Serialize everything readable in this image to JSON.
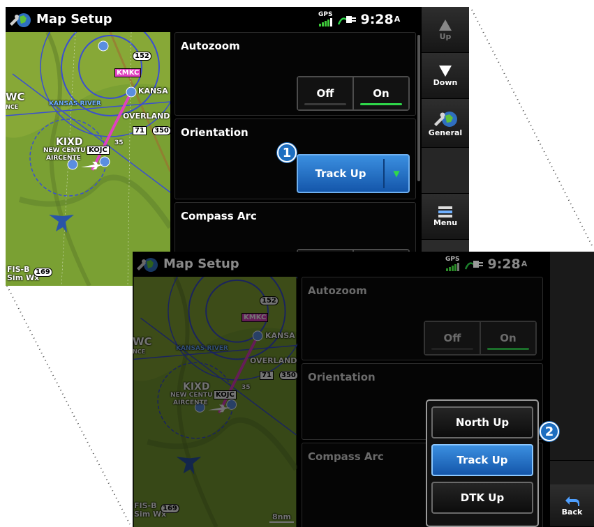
{
  "screen1": {
    "title": "Map Setup",
    "time": "9:28",
    "time_suffix": "A",
    "gps_label": "GPS",
    "sections": {
      "autozoom": {
        "title": "Autozoom",
        "off": "Off",
        "on": "On"
      },
      "orientation": {
        "title": "Orientation",
        "value": "Track Up"
      },
      "compass_arc": {
        "title": "Compass Arc"
      }
    },
    "softkeys": {
      "up": "Up",
      "down": "Down",
      "general": "General",
      "menu": "Menu"
    },
    "callout": "1",
    "map": {
      "labels": {
        "kmkc": "KMKC",
        "kansas": "KANSA",
        "kansas_river": "KANSAS RIVER",
        "overland": "OVERLAND",
        "kixd": "KIXD",
        "new_centu": "NEW CENTU",
        "aircente": "AIRCENTE",
        "kojc": "KOJC",
        "wc": "WC",
        "nce": "NCE",
        "r152": "152",
        "r71": "71",
        "r350": "350",
        "r35": "35",
        "fisb": "FIS-B",
        "simwx": "Sim Wx",
        "r169": "169"
      }
    }
  },
  "screen2": {
    "title": "Map Setup",
    "time": "9:28",
    "time_suffix": "A",
    "gps_label": "GPS",
    "sections": {
      "autozoom": {
        "title": "Autozoom",
        "off": "Off",
        "on": "On"
      },
      "orientation": {
        "title": "Orientation"
      },
      "compass_arc": {
        "title": "Compass Arc"
      }
    },
    "dropdown": [
      "North Up",
      "Track Up",
      "DTK Up"
    ],
    "selected": "Track Up",
    "softkeys": {
      "back": "Back"
    },
    "callout": "2",
    "map": {
      "labels": {
        "kmkc": "KMKC",
        "kansas": "KANSA",
        "kansas_river": "KANSAS RIVER",
        "overland": "OVERLAND",
        "kixd": "KIXD",
        "new_centu": "NEW CENTU",
        "aircente": "AIRCENTE",
        "kojc": "KOJC",
        "wc": "WC",
        "nce": "NCE",
        "r152": "152",
        "r71": "71",
        "r350": "350",
        "r35": "35",
        "fisb": "FIS-B",
        "simwx": "Sim Wx",
        "r169": "169",
        "scale": "8nm"
      }
    }
  },
  "colors": {
    "accent_blue": "#1d6ec0",
    "on_green": "#2fd84a",
    "route_magenta": "#e040c0",
    "map_green": "#6f9a30"
  }
}
